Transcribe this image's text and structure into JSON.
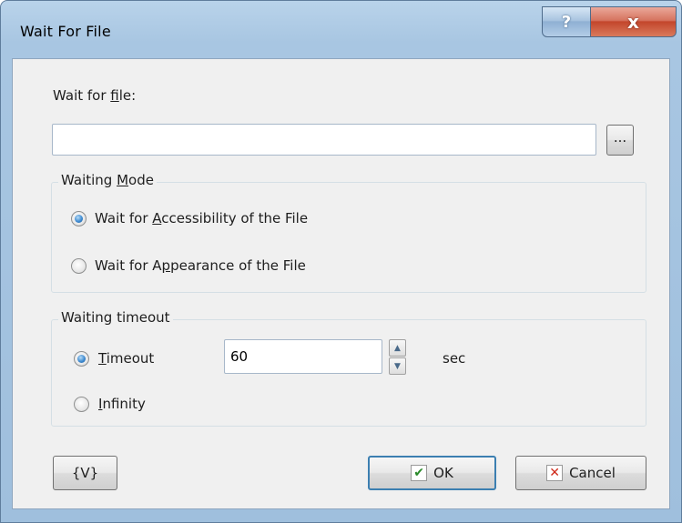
{
  "window": {
    "title": "Wait For File",
    "help_glyph": "?",
    "close_glyph": "x"
  },
  "file": {
    "label": "Wait for file:",
    "value": "",
    "browse_label": "..."
  },
  "waiting_mode": {
    "title": "Waiting Mode",
    "options": [
      {
        "label": "Wait for Accessibility of the File",
        "checked": true
      },
      {
        "label": "Wait for Appearance of the File",
        "checked": false
      }
    ]
  },
  "timeout": {
    "title": "Waiting timeout",
    "timeout_label": "Timeout",
    "infinity_label": "Infinity",
    "value": "60",
    "unit": "sec",
    "selected": "Timeout"
  },
  "buttons": {
    "variables": "{V}",
    "ok": "OK",
    "cancel": "Cancel"
  },
  "icons": {
    "ok_icon": "check-icon",
    "cancel_icon": "x-icon",
    "spin_up": "chevron-up-icon",
    "spin_down": "chevron-down-icon"
  },
  "colors": {
    "title_bar": "#a8c6e2",
    "close_button": "#c3462c",
    "radio_selected": "#3f8bd1"
  }
}
